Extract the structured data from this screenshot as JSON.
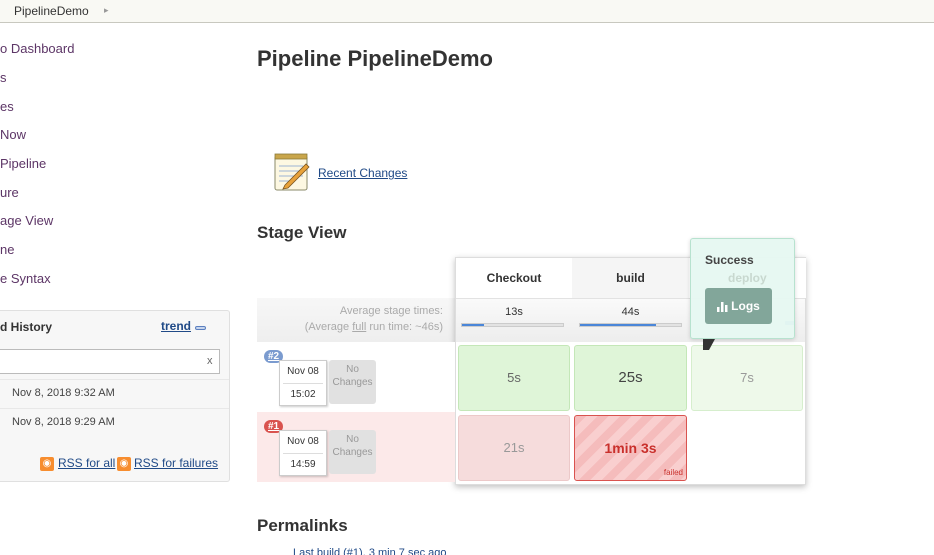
{
  "breadcrumb": {
    "item": "PipelineDemo"
  },
  "sidebar": {
    "links": [
      "o Dashboard",
      "s",
      "es",
      "Now",
      " Pipeline",
      "ure",
      "age View",
      "ne",
      "e Syntax"
    ]
  },
  "build_history": {
    "title": "d History",
    "trend_label": "trend",
    "search_clear": "x",
    "entries": [
      "Nov 8, 2018 9:32 AM",
      "Nov 8, 2018 9:29 AM"
    ],
    "rss_all": "RSS for all",
    "rss_failures": "RSS for failures"
  },
  "main": {
    "title": "Pipeline PipelineDemo",
    "recent_changes": "Recent Changes",
    "stage_view_title": "Stage View",
    "permalinks_title": "Permalinks",
    "permalink_first": "Last build (#1), 3 min 7 sec ago"
  },
  "stage_view": {
    "avg_stage_label": "Average stage times:",
    "avg_run_prefix": "(Average ",
    "avg_run_full": "full",
    "avg_run_suffix": " run time: ~46s)",
    "stages": [
      {
        "name": "Checkout",
        "avg": "13s",
        "avg_fraction": 0.22
      },
      {
        "name": "build",
        "avg": "44s",
        "avg_fraction": 0.75
      },
      {
        "name": "deploy",
        "avg": "",
        "avg_fraction": 0.1
      }
    ],
    "runs": [
      {
        "badge": "#2",
        "date": "Nov 08",
        "time": "15:02",
        "changes": "No Changes",
        "cells": [
          "5s",
          "25s",
          "7s"
        ]
      },
      {
        "badge": "#1",
        "date": "Nov 08",
        "time": "14:59",
        "changes": "No Changes",
        "cells": [
          "21s",
          "1min 3s",
          ""
        ],
        "failed_label": "failed"
      }
    ],
    "popover": {
      "status": "Success",
      "stage": "deploy",
      "logs_label": "Logs"
    }
  },
  "colors": {
    "success": "#dff5d8",
    "failure": "#d9534f",
    "link": "#204a87",
    "badge_ok": "#7b9bcf",
    "badge_fail": "#d9534f"
  }
}
